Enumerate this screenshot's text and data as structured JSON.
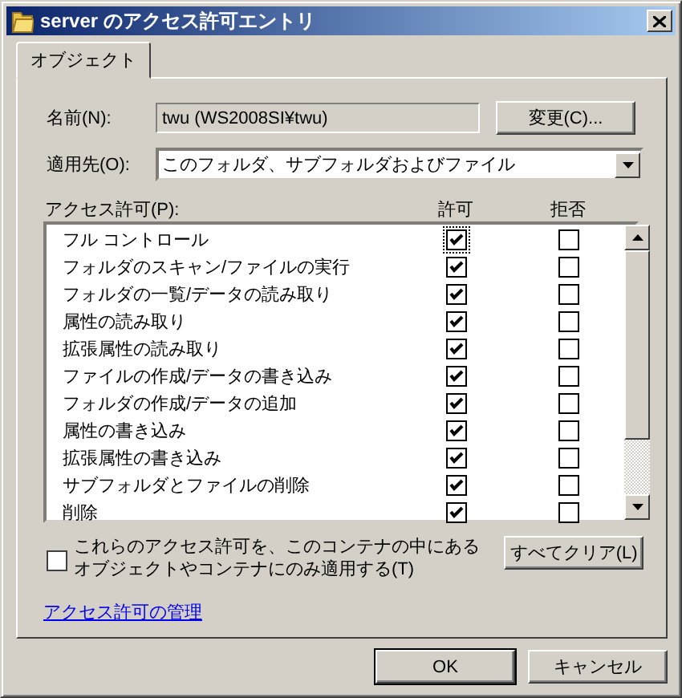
{
  "window": {
    "title": "server のアクセス許可エントリ"
  },
  "tabs": [
    {
      "label": "オブジェクト",
      "selected": true
    }
  ],
  "name": {
    "label": "名前(N):",
    "value": "twu (WS2008SI¥twu)"
  },
  "change_button": "変更(C)...",
  "apply_to": {
    "label": "適用先(O):",
    "value": "このフォルダ、サブフォルダおよびファイル"
  },
  "permissions": {
    "label": "アクセス許可(P):",
    "columns": [
      "許可",
      "拒否"
    ],
    "rows": [
      {
        "name": "フル コントロール",
        "allow": true,
        "deny": false,
        "focused": true
      },
      {
        "name": "フォルダのスキャン/ファイルの実行",
        "allow": true,
        "deny": false,
        "focused": false
      },
      {
        "name": "フォルダの一覧/データの読み取り",
        "allow": true,
        "deny": false,
        "focused": false
      },
      {
        "name": "属性の読み取り",
        "allow": true,
        "deny": false,
        "focused": false
      },
      {
        "name": "拡張属性の読み取り",
        "allow": true,
        "deny": false,
        "focused": false
      },
      {
        "name": "ファイルの作成/データの書き込み",
        "allow": true,
        "deny": false,
        "focused": false
      },
      {
        "name": "フォルダの作成/データの追加",
        "allow": true,
        "deny": false,
        "focused": false
      },
      {
        "name": "属性の書き込み",
        "allow": true,
        "deny": false,
        "focused": false
      },
      {
        "name": "拡張属性の書き込み",
        "allow": true,
        "deny": false,
        "focused": false
      },
      {
        "name": "サブフォルダとファイルの削除",
        "allow": true,
        "deny": false,
        "focused": false
      },
      {
        "name": "削除",
        "allow": true,
        "deny": false,
        "focused": false
      }
    ]
  },
  "apply_only": {
    "label": "これらのアクセス許可を、このコンテナの中にあるオブジェクトやコンテナにのみ適用する(T)",
    "checked": false
  },
  "clear_all_button": "すべてクリア(L)",
  "manage_link": "アクセス許可の管理",
  "buttons": [
    {
      "label": "OK",
      "default": true
    },
    {
      "label": "キャンセル",
      "default": false
    }
  ]
}
